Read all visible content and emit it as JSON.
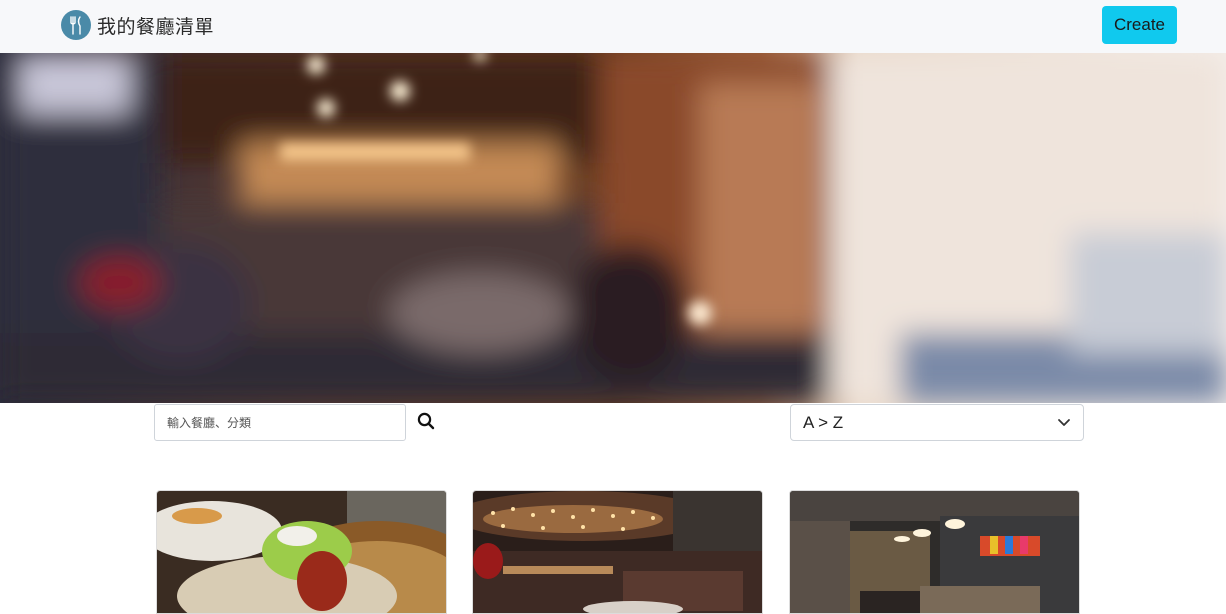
{
  "navbar": {
    "brand_title": "我的餐廳清單",
    "brand_icon": "fork-knife-icon",
    "create_label": "Create",
    "accent_color": "#10c9ee"
  },
  "banner": {
    "image": "blurred-restaurant-interior"
  },
  "search": {
    "placeholder": "輸入餐廳、分類",
    "icon": "search-icon"
  },
  "sort": {
    "selected": "A > Z",
    "icon": "chevron-down-icon"
  },
  "restaurants": [
    {
      "image": "food-wrap-dish"
    },
    {
      "image": "restaurant-dining-hall"
    },
    {
      "image": "restaurant-private-room"
    }
  ]
}
